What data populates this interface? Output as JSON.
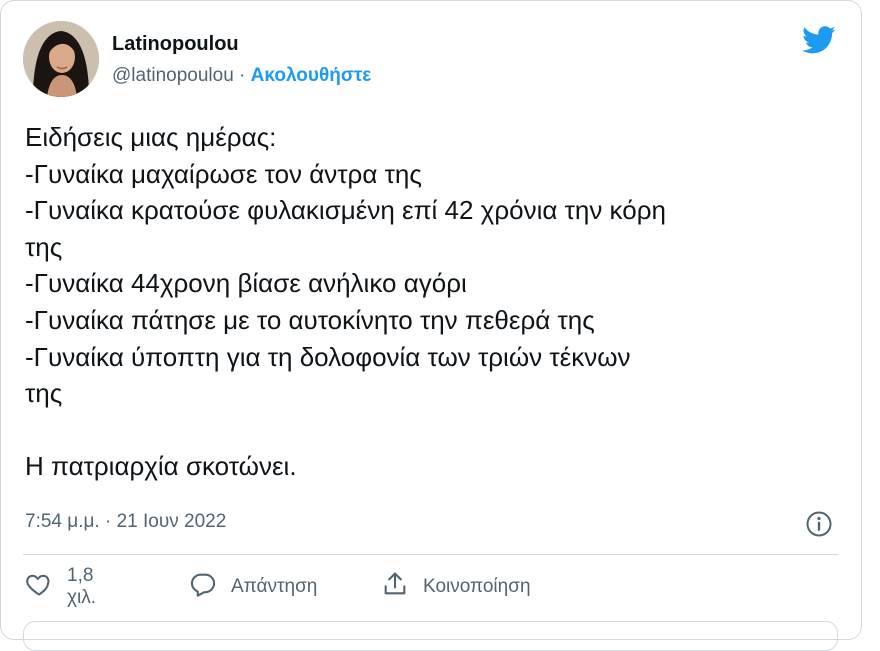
{
  "author": {
    "display_name": "Latinopoulou",
    "handle": "@latinopoulou",
    "separator": "·",
    "follow_label": "Ακολουθήστε"
  },
  "tweet": {
    "lines": [
      "Ειδήσεις μιας ημέρας:",
      "-Γυναίκα μαχαίρωσε τον άντρα της",
      "-Γυναίκα κρατούσε φυλακισμένη επί 42 χρόνια την κόρη",
      "της",
      "-Γυναίκα 44χρονη βίασε ανήλικο αγόρι",
      "-Γυναίκα πάτησε με το αυτοκίνητο την πεθερά της",
      "-Γυναίκα ύποπτη για τη δολοφονία των τριών τέκνων",
      "της"
    ],
    "closing": "Η πατριαρχία σκοτώνει.",
    "timestamp": "7:54 μ.μ. · 21 Ιουν 2022"
  },
  "actions": {
    "like_count": "1,8 χιλ.",
    "reply_label": "Απάντηση",
    "share_label": "Κοινοποίηση"
  },
  "icons": {
    "brand": "twitter-bird-icon",
    "info": "info-icon",
    "like": "heart-icon",
    "reply": "reply-bubble-icon",
    "share": "share-icon"
  },
  "colors": {
    "accent": "#1d9bf0",
    "text": "#0f1419",
    "secondary": "#536471",
    "border": "#cfd9de"
  }
}
